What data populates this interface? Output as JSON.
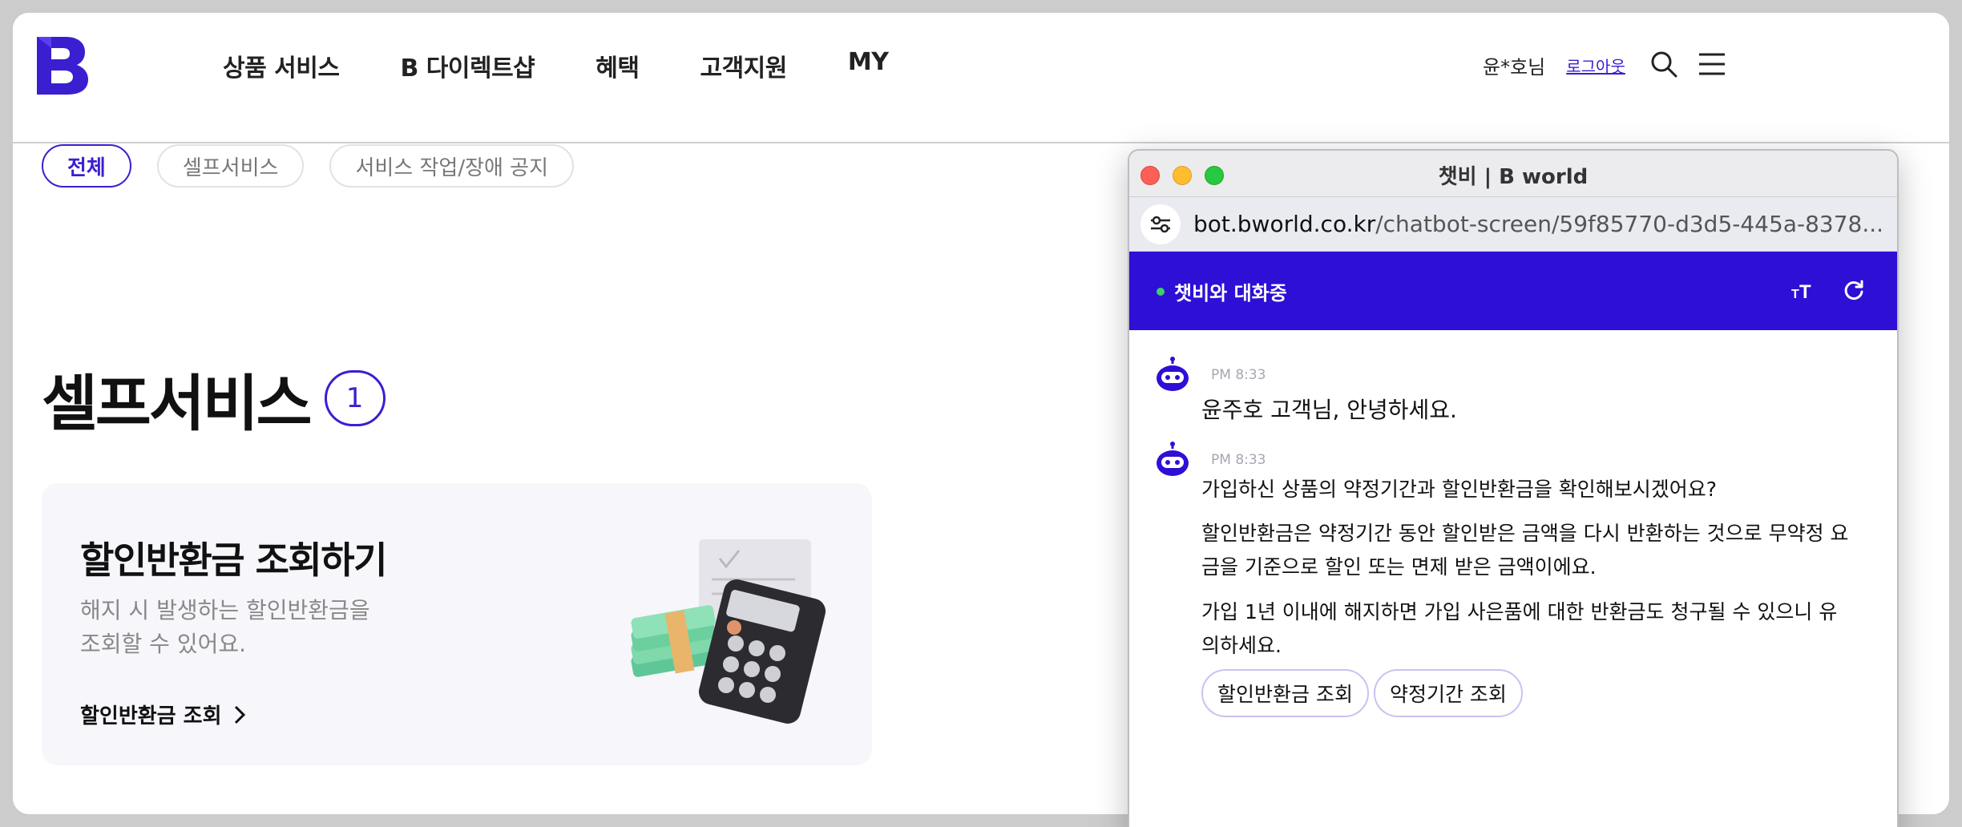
{
  "header": {
    "nav": [
      "상품 서비스",
      "B 다이렉트샵",
      "혜택",
      "고객지원",
      "MY"
    ],
    "user_name": "윤*호님",
    "logout_label": "로그아웃",
    "brand_color": "#3a1fd0"
  },
  "filters": {
    "chips": [
      "전체",
      "셀프서비스",
      "서비스 작업/장애 공지"
    ],
    "active": "전체"
  },
  "section": {
    "title": "셀프서비스",
    "count": "1"
  },
  "card": {
    "title": "할인반환금 조회하기",
    "desc_line1": "해지 시 발생하는 할인반환금을",
    "desc_line2": "조회할 수 있어요.",
    "link_label": "할인반환금 조회"
  },
  "chatbot_window": {
    "title": "챗비 | B world",
    "url_host": "bot.bworld.co.kr",
    "url_path": "/chatbot-screen/59f85770-d3d5-445a-8378...",
    "status": "챗비와 대화중",
    "header_color": "#2d0fd6",
    "messages": [
      {
        "time": "PM 8:33",
        "text": "윤주호 고객님, 안녕하세요."
      },
      {
        "time": "PM 8:33",
        "para1": "가입하신 상품의 약정기간과 할인반환금을 확인해보시겠어요?",
        "para2": "할인반환금은 약정기간 동안 할인받은 금액을 다시 반환하는 것으로 무약정 요금을 기준으로 할인 또는 면제 받은 금액이에요.",
        "para3": "가입 1년 이내에 해지하면 가입 사은품에 대한 반환금도 청구될 수 있으니 유의하세요.",
        "quick_replies": [
          "할인반환금 조회",
          "약정기간 조회"
        ]
      }
    ]
  }
}
